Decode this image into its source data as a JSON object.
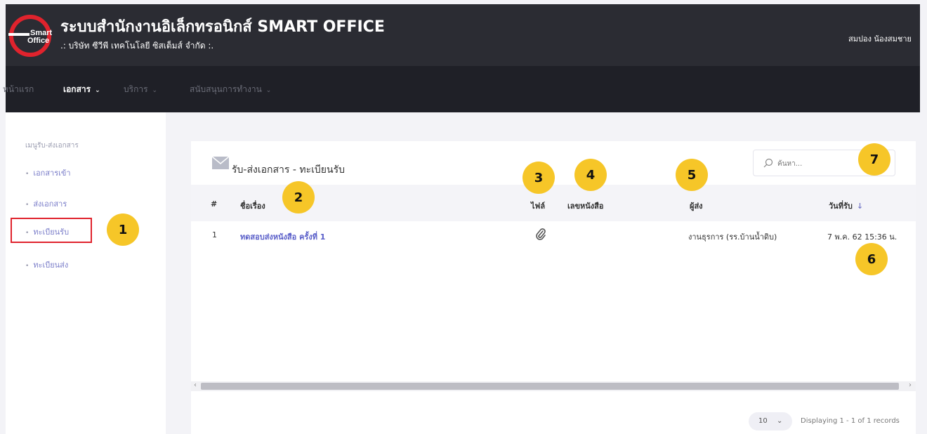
{
  "header": {
    "app_title": "ระบบสำนักงานอิเล็กทรอนิกส์ SMART OFFICE",
    "company": ".: บริษัท ซีวีพี เทคโนโลยี ซิสเต็มส์ จำกัด :.",
    "user_name": "สมปอง น้องสมชาย",
    "logo_text": "Smart Office"
  },
  "nav": {
    "items": [
      {
        "label": "หน้าแรก"
      },
      {
        "label": "เอกสาร",
        "active": true
      },
      {
        "label": "บริการ"
      },
      {
        "label": "สนับสนุนการทำงาน"
      }
    ]
  },
  "sidebar": {
    "heading": "เมนูรับ-ส่งเอกสาร",
    "items": [
      {
        "label": "เอกสารเข้า"
      },
      {
        "label": "ส่งเอกสาร"
      },
      {
        "label": "ทะเบียนรับ",
        "selected": true
      },
      {
        "label": "ทะเบียนส่ง"
      }
    ]
  },
  "panel": {
    "title": "รับ-ส่งเอกสาร - ทะเบียนรับ",
    "search_placeholder": "ค้นหา...",
    "columns": {
      "no": "#",
      "subject": "ชื่อเรื่อง",
      "file": "ไฟล์",
      "doc_no": "เลขหนังสือ",
      "sender": "ผู้ส่ง",
      "received": "วันที่รับ"
    },
    "rows": [
      {
        "no": "1",
        "subject": "ทดสอบส่งหนังสือ ครั้งที่ 1",
        "doc_no": "",
        "sender": "งานธุรการ (รร.บ้านน้ำดิบ)",
        "received": "7 พ.ค. 62 15:36 น."
      }
    ],
    "page_size": "10",
    "display_info": "Displaying 1 - 1 of 1 records"
  },
  "badges": {
    "b1": "1",
    "b2": "2",
    "b3": "3",
    "b4": "4",
    "b5": "5",
    "b6": "6",
    "b7": "7"
  },
  "colors": {
    "header_bg": "#2b2c33",
    "nav_bg": "#1f2027",
    "badge": "#f6c628",
    "link": "#5a5fc9",
    "highlight": "#e0232d"
  }
}
